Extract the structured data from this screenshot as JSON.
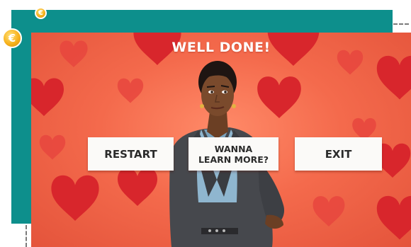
{
  "game": {
    "title": "WELL DONE!",
    "buttons": {
      "restart": "RESTART",
      "learn_more": "WANNA\nLEARN MORE?",
      "exit": "EXIT"
    },
    "coin_symbol": "€",
    "icons": [
      "coin-icon",
      "heart-icon",
      "character"
    ]
  },
  "colors": {
    "frame_teal": "#0d8f8c",
    "background_coral": "#f46a4c",
    "heart_red": "#d8262c",
    "button_white": "#fbfaf8",
    "coin_gold": "#f7b21c"
  }
}
